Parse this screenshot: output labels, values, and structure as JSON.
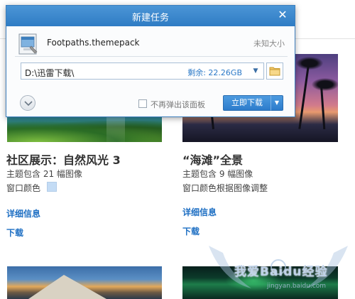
{
  "dialog": {
    "title": "新建任务",
    "close_icon": "close-icon",
    "file": {
      "icon": "theme-file-icon",
      "name": "Footpaths.themepack",
      "size": "未知大小"
    },
    "path": {
      "value": "D:\\迅雷下载\\",
      "free_space": "剩余: 22.26GB",
      "dropdown_icon": "chevron-down-icon",
      "browse_icon": "folder-icon"
    },
    "expand_icon": "chevron-down-circle-icon",
    "no_popup_label": "不再弹出该面板",
    "no_popup_checked": false,
    "download_label": "立即下载",
    "download_menu_icon": "caret-down-icon"
  },
  "themes": [
    {
      "title": "社区展示：自然风光 3",
      "count_line": "主题包含 21 幅图像",
      "color_line": "窗口颜色",
      "color": "#c4dcf5",
      "details_link": "详细信息",
      "download_link": "下载"
    },
    {
      "title": "“海滩”全景",
      "count_line": "主题包含 9 幅图像",
      "color_line": "窗口颜色根据图像调整",
      "details_link": "详细信息",
      "download_link": "下载"
    }
  ],
  "watermark": {
    "main": "我爱Baidu经验",
    "sub": "jingyan.baidu.com"
  },
  "colors": {
    "titlebar": "#2f7cc4",
    "link": "#1e6fc3",
    "button": "#2d7ccb",
    "free_space": "#2a78c7"
  }
}
